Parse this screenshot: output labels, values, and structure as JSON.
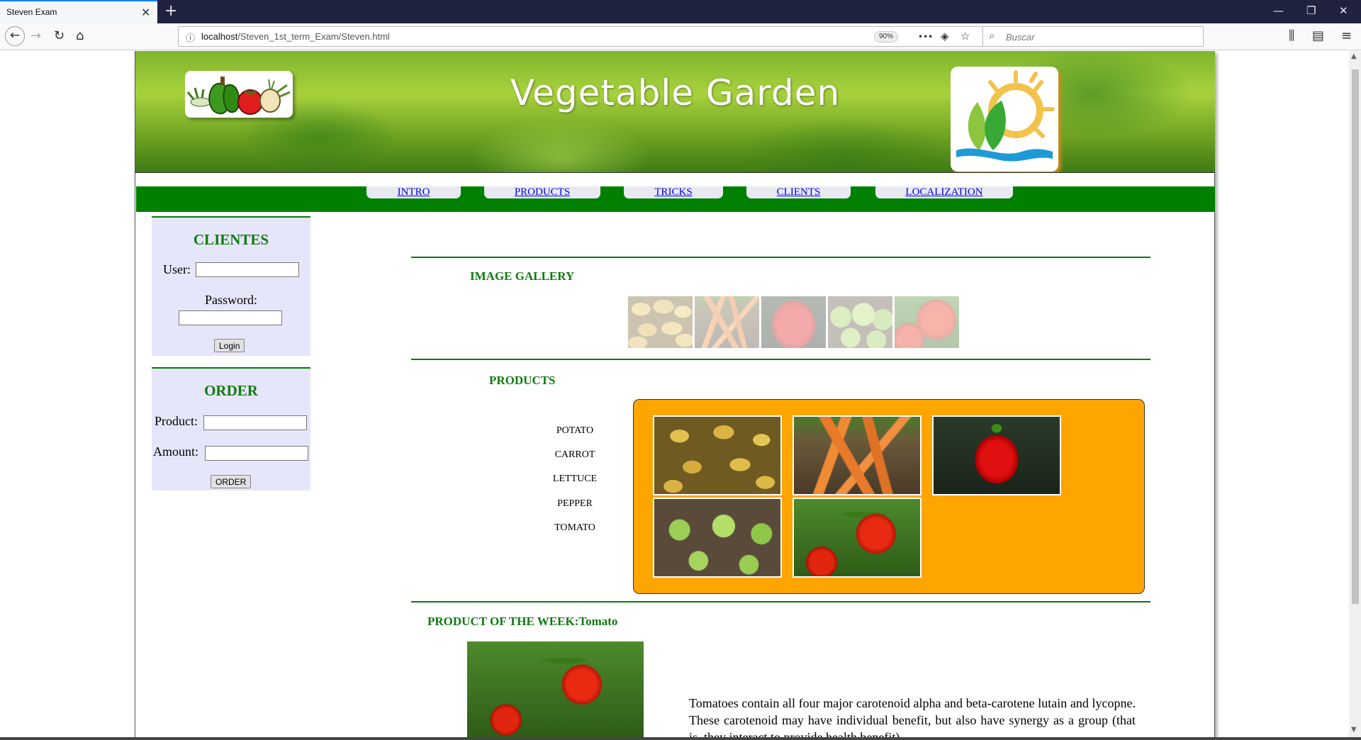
{
  "browser": {
    "tab_title": "Steven Exam",
    "tab_close": "✕",
    "new_tab": "+",
    "url_host": "localhost",
    "url_path": "/Steven_1st_term_Exam/Steven.html",
    "zoom": "90%",
    "search_placeholder": "Buscar",
    "icons": {
      "back": "←",
      "forward": "→",
      "reload": "↻",
      "home": "⌂",
      "more": "•••",
      "pocket": "◈",
      "bookmark": "☆",
      "search": "⌕",
      "library": "⫼",
      "sidebar": "▤",
      "menu": "≡",
      "minimize": "—",
      "restore": "❐",
      "close": "✕"
    }
  },
  "header": {
    "title": "Vegetable Garden"
  },
  "menu": {
    "items": [
      "INTRO",
      "PRODUCTS",
      "TRICKS",
      "CLIENTS",
      "LOCALIZATION"
    ]
  },
  "clientes": {
    "title": "CLIENTES",
    "user_label": "User:",
    "user_value": "",
    "password_label": "Password:",
    "password_value": "",
    "login_button": "Login"
  },
  "order": {
    "title": "ORDER",
    "product_label": "Product:",
    "product_value": "",
    "amount_label": "Amount:",
    "amount_value": "",
    "order_button": "ORDER"
  },
  "gallery": {
    "title": "IMAGE GALLERY",
    "images": [
      "potato",
      "carrot",
      "pepper",
      "lettuce",
      "tomato"
    ]
  },
  "products": {
    "title": "PRODUCTS",
    "names": [
      "POTATO",
      "CARROT",
      "LETTUCE",
      "PEPPER",
      "TOMATO"
    ],
    "images": [
      "potato",
      "carrot",
      "pepper",
      "lettuce",
      "tomato"
    ]
  },
  "product_of_week": {
    "title": "PRODUCT OF THE WEEK:Tomato",
    "text": "Tomatoes contain all four major carotenoid alpha and beta-carotene lutain and lycopne. These carotenoid may have individual benefit, but also have synergy as a group (that is, they interact to provide health benefit)."
  },
  "colors": {
    "menu_bar": "#008000",
    "section_title": "#0f7a0f",
    "sidebar_bg": "#e6e6fa",
    "product_box": "#ffa500",
    "link": "#0000ee"
  }
}
